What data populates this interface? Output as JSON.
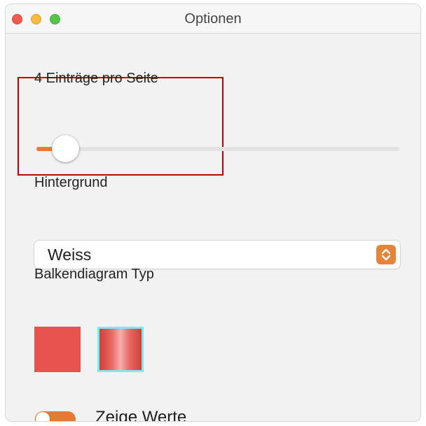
{
  "window": {
    "title": "Optionen"
  },
  "entries_slider": {
    "label": "4 Einträge pro Seite",
    "value": 4,
    "fraction": 0.08,
    "accent_color": "#e27b33"
  },
  "background_select": {
    "label": "Hintergrund",
    "value": "Weiss",
    "stepper_icon": "chevron-up-down-icon",
    "accent_color": "#e5843a"
  },
  "bar_chart_type": {
    "label": "Balkendiagram Typ",
    "options": [
      {
        "name": "solid",
        "color": "#e9534e",
        "selected": false
      },
      {
        "name": "gradient",
        "color": "#cf3f3a",
        "selected": true,
        "selection_color": "#7fe9f2"
      }
    ]
  },
  "show_values_toggle": {
    "label": "Zeige Werte",
    "on": true,
    "accent_color": "#e27b33"
  },
  "highlight_box": {
    "color": "#c00000"
  }
}
